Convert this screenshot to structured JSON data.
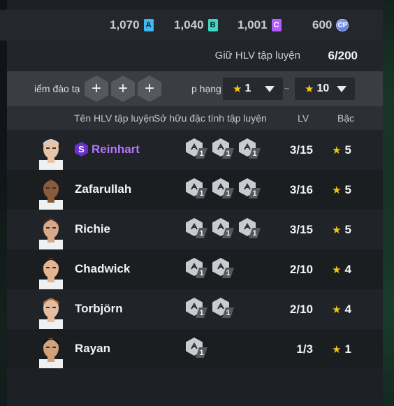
{
  "currencies": [
    {
      "value": "1,070",
      "badge": "A",
      "color": "#3fb8f0"
    },
    {
      "value": "1,040",
      "badge": "B",
      "color": "#3ed8c0"
    },
    {
      "value": "1,001",
      "badge": "C",
      "color": "#b45cff"
    },
    {
      "value": "600",
      "badge": "CP",
      "color": "#6a82e8"
    }
  ],
  "capacity": {
    "label": "Giữ HLV tập luyện",
    "value": "6/200"
  },
  "filters": {
    "points_label": "iểm đào tạ",
    "rank_label": "p hạng",
    "add_symbol": "+",
    "min_rank": "1",
    "max_rank": "10",
    "separator": "~"
  },
  "headers": {
    "name": "Tên HLV tập luyện",
    "traits": "Sở hữu đặc tính tập luyện",
    "level": "LV",
    "rank": "Bậc"
  },
  "coaches": [
    {
      "name": "Reinhart",
      "special": true,
      "special_badge": "S",
      "traits": [
        {
          "icon": "trait-icon",
          "lv": "1"
        },
        {
          "icon": "trait-icon",
          "lv": "1"
        },
        {
          "icon": "trait-icon",
          "lv": "1"
        }
      ],
      "level": "3/15",
      "rank": "5"
    },
    {
      "name": "Zafarullah",
      "special": false,
      "traits": [
        {
          "icon": "trait-icon",
          "lv": "1"
        },
        {
          "icon": "trait-icon",
          "lv": "1"
        },
        {
          "icon": "trait-icon",
          "lv": "1"
        }
      ],
      "level": "3/16",
      "rank": "5"
    },
    {
      "name": "Richie",
      "special": false,
      "traits": [
        {
          "icon": "trait-icon",
          "lv": "1"
        },
        {
          "icon": "trait-icon",
          "lv": "1"
        },
        {
          "icon": "trait-icon",
          "lv": "1"
        }
      ],
      "level": "3/15",
      "rank": "5"
    },
    {
      "name": "Chadwick",
      "special": false,
      "traits": [
        {
          "icon": "trait-icon",
          "lv": "1"
        },
        {
          "icon": "trait-icon",
          "lv": "1"
        }
      ],
      "level": "2/10",
      "rank": "4"
    },
    {
      "name": "Torbjörn",
      "special": false,
      "traits": [
        {
          "icon": "trait-icon",
          "lv": "1"
        },
        {
          "icon": "trait-icon",
          "lv": "1"
        }
      ],
      "level": "2/10",
      "rank": "4"
    },
    {
      "name": "Rayan",
      "special": false,
      "traits": [
        {
          "icon": "trait-icon",
          "lv": "1"
        }
      ],
      "level": "1/3",
      "rank": "1"
    }
  ],
  "colors": {
    "accent_star": "#f5c518",
    "special_name": "#b476ff"
  }
}
